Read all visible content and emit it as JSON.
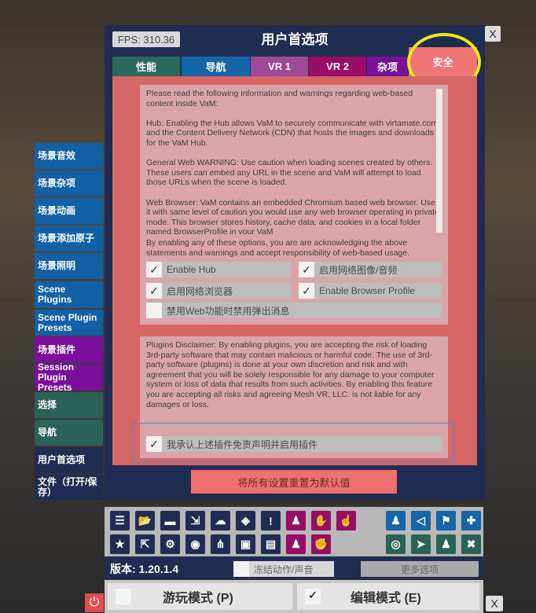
{
  "header": {
    "fps": "FPS: 310.36",
    "title": "用户首选项",
    "close": "X"
  },
  "tabs": [
    {
      "label": "性能",
      "color": "#2a6a5c"
    },
    {
      "label": "导航",
      "color": "#1566a8"
    },
    {
      "label": "VR 1",
      "color": "#a04898"
    },
    {
      "label": "VR 2",
      "color": "#960c66"
    },
    {
      "label": "杂项",
      "color": "#7a0f9a"
    },
    {
      "label": "安全",
      "color": "#f07474",
      "active": true
    }
  ],
  "security": {
    "info": [
      "Please read the following information and warnings regarding web-based content inside VaM:",
      "Hub: Enabling the Hub allows VaM to securely communicate with virtamate.com and the Content Delivery Network (CDN) that hosts the images and downloads for the VaM Hub.",
      "General Web WARNING: Use caution when loading scenes created by others. These users can embed any URL in the scene and VaM will attempt to load those URLs when the scene is loaded.",
      "Web Browser: VaM contains an embedded Chromium based web browser. Use it with same level of caution you would use any web browser operating in private mode. This browser stores history, cache data, and cookies in a local folder named BrowserProfile in your VaM"
    ],
    "ack": "By enabling any of these options, you are are acknowledging the above statements and warnings and accept responsibility of web-based usage.",
    "options": [
      {
        "label": "Enable Hub",
        "checked": true
      },
      {
        "label": "启用网络图像/音频",
        "checked": true
      },
      {
        "label": "启用网络浏览器",
        "checked": true
      },
      {
        "label": "Enable Browser Profile",
        "checked": true
      },
      {
        "label": "禁用Web功能时禁用弹出消息",
        "checked": false
      }
    ],
    "plugins_disclaimer": "Plugins Disclaimer: By enabling plugins, you are accepting the risk of loading 3rd-party software that may contain malicious or harmful code. The use of 3rd-party software (plugins) is done at your own discretion and risk and with agreement that you will be solely responsible for any damage to your computer system or loss of data that results from such activities. By enabling this feature you are accepting all risks and agreeing Mesh VR, LLC. is not liable for any damages or loss.",
    "plugins_option": {
      "label": "我承认上述插件免责声明并启用插件",
      "checked": true
    },
    "reset": "将所有设置重置为默认值"
  },
  "sidebar": [
    {
      "label": "场景音效",
      "color": "#1260a5"
    },
    {
      "label": "场景杂项",
      "color": "#1260a5"
    },
    {
      "label": "场景动画",
      "color": "#1260a5"
    },
    {
      "label": "场景添加原子",
      "color": "#1260a5"
    },
    {
      "label": "场景照明",
      "color": "#1260a5"
    },
    {
      "label": "Scene Plugins",
      "color": "#1260a5"
    },
    {
      "label": "Scene Plugin Presets",
      "color": "#1260a5"
    },
    {
      "label": "场景插件",
      "color": "#7a0f9a"
    },
    {
      "label": "Session Plugin Presets",
      "color": "#7a0f9a"
    },
    {
      "label": "选择",
      "color": "#2a6258"
    },
    {
      "label": "导航",
      "color": "#2a6258"
    },
    {
      "label": "用户首选项",
      "color": "#1f2d52"
    },
    {
      "label": "文件（打开/保存）",
      "color": "#1f2d52"
    }
  ],
  "toolbar": {
    "icons": [
      {
        "name": "menu-icon",
        "glyph": "☰",
        "color": "#1f2d52"
      },
      {
        "name": "open-folder-icon",
        "glyph": "📂",
        "color": "#1f2d52"
      },
      {
        "name": "folder-icon",
        "glyph": "▬",
        "color": "#1f2d52"
      },
      {
        "name": "save-icon",
        "glyph": "⇲",
        "color": "#1f2d52"
      },
      {
        "name": "cloud-download-icon",
        "glyph": "☁",
        "color": "#1f2d52"
      },
      {
        "name": "cube-icon",
        "glyph": "◈",
        "color": "#1f2d52"
      },
      {
        "name": "alert-icon",
        "glyph": "!",
        "color": "#1f2d52"
      },
      {
        "name": "person-info-icon",
        "glyph": "♟",
        "color": "#960c66"
      },
      {
        "name": "hand-icon",
        "glyph": "✋",
        "color": "#960c66"
      },
      {
        "name": "touch-icon",
        "glyph": "☝",
        "color": "#960c66"
      },
      {
        "name": "star-icon",
        "glyph": "★",
        "color": "#1f2d52"
      },
      {
        "name": "open-folder-alt-icon",
        "glyph": "⇱",
        "color": "#1f2d52"
      },
      {
        "name": "folder-settings-icon",
        "glyph": "⚙",
        "color": "#1f2d52"
      },
      {
        "name": "camera-icon",
        "glyph": "◉",
        "color": "#1f2d52"
      },
      {
        "name": "nodes-icon",
        "glyph": "⋔",
        "color": "#1f2d52"
      },
      {
        "name": "box-open-icon",
        "glyph": "▣",
        "color": "#1f2d52"
      },
      {
        "name": "document-icon",
        "glyph": "▤",
        "color": "#1f2d52"
      },
      {
        "name": "person-remove-icon",
        "glyph": "♟",
        "color": "#960c66"
      },
      {
        "name": "grab-icon",
        "glyph": "✊",
        "color": "#960c66"
      }
    ],
    "right_icons": [
      {
        "name": "person-icon",
        "glyph": "♟",
        "color": "#1566a8"
      },
      {
        "name": "unity-icon",
        "glyph": "◁",
        "color": "#1566a8"
      },
      {
        "name": "flag-icon",
        "glyph": "⚑",
        "color": "#1566a8"
      },
      {
        "name": "plus-icon",
        "glyph": "✚",
        "color": "#1566a8"
      },
      {
        "name": "target-icon",
        "glyph": "◎",
        "color": "#2a6258"
      },
      {
        "name": "cursor-icon",
        "glyph": "➤",
        "color": "#2a6258"
      },
      {
        "name": "people-icon",
        "glyph": "♟",
        "color": "#2a6258"
      },
      {
        "name": "tools-icon",
        "glyph": "✖",
        "color": "#2a6258"
      }
    ]
  },
  "version": "版本: 1.20.1.4",
  "freeze": {
    "label": "冻结动作/声音",
    "checked": false
  },
  "more": "更多选项",
  "play_mode": {
    "label": "游玩模式 (P)",
    "checked": false
  },
  "edit_mode": {
    "label": "编辑模式 (E)",
    "checked": true
  },
  "bottom_close": "X"
}
